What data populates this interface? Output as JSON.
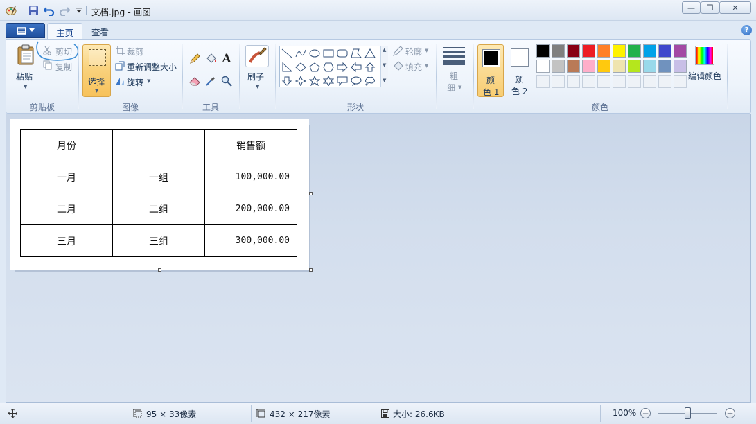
{
  "window": {
    "title": "文档.jpg - 画图",
    "min_label": "—",
    "max_label": "❐",
    "close_label": "✕"
  },
  "tabs": [
    {
      "label": "主页",
      "active": true
    },
    {
      "label": "查看",
      "active": false
    }
  ],
  "help_label": "?",
  "ribbon": {
    "clipboard": {
      "group_label": "剪贴板",
      "paste_label": "粘贴",
      "cut_label": "剪切",
      "copy_label": "复制"
    },
    "image": {
      "group_label": "图像",
      "select_label": "选择",
      "crop_label": "裁剪",
      "resize_label": "重新调整大小",
      "rotate_label": "旋转"
    },
    "tools": {
      "group_label": "工具",
      "brush_label": "刷子",
      "text_tool_glyph": "A"
    },
    "shapes": {
      "group_label": "形状",
      "outline_label": "轮廓",
      "fill_label": "填充"
    },
    "size": {
      "label_1": "粗",
      "label_2": "细"
    },
    "colors": {
      "group_label": "颜色",
      "color1_label_1": "颜",
      "color1_label_2": "色 1",
      "color2_label_1": "颜",
      "color2_label_2": "色 2",
      "edit_colors_label": "编辑颜色",
      "color1_value": "#000000",
      "color2_value": "#ffffff",
      "palette_row1": [
        "#000000",
        "#7f7f7f",
        "#880015",
        "#ed1c24",
        "#ff7f27",
        "#fff200",
        "#22b14c",
        "#00a2e8",
        "#3f48cc",
        "#a349a4"
      ],
      "palette_row2": [
        "#ffffff",
        "#c3c3c3",
        "#b97a57",
        "#ffaec9",
        "#ffc90e",
        "#efe4b0",
        "#b5e61d",
        "#99d9ea",
        "#7092be",
        "#c8bfe7"
      ]
    }
  },
  "canvas": {
    "table": {
      "rows": [
        [
          "月份",
          "",
          "销售额"
        ],
        [
          "一月",
          "一组",
          "100,000.00"
        ],
        [
          "二月",
          "二组",
          "200,000.00"
        ],
        [
          "三月",
          "三组",
          "300,000.00"
        ]
      ]
    }
  },
  "status": {
    "selection_size": "95 × 33像素",
    "image_size": "432 × 217像素",
    "file_size": "大小: 26.6KB",
    "zoom": "100%",
    "zoom_out": "−",
    "zoom_in": "+"
  }
}
